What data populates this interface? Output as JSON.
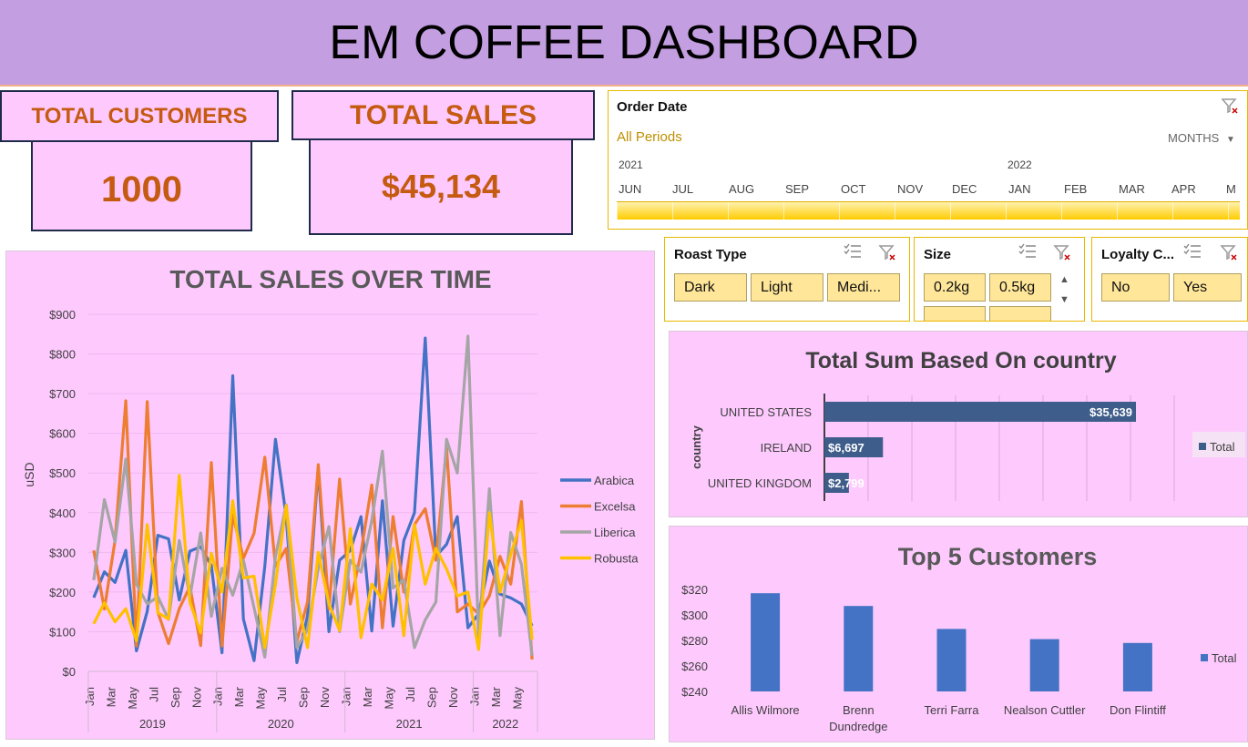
{
  "header": {
    "title": "EM COFFEE DASHBOARD"
  },
  "kpis": {
    "customers_label": "TOTAL CUSTOMERS",
    "customers_value": "1000",
    "sales_label": "TOTAL SALES",
    "sales_value": "$45,134"
  },
  "timeline": {
    "title": "Order Date",
    "periods": "All Periods",
    "unit": "MONTHS",
    "years": [
      "2021",
      "2022"
    ],
    "months": [
      "JUN",
      "JUL",
      "AUG",
      "SEP",
      "OCT",
      "NOV",
      "DEC",
      "JAN",
      "FEB",
      "MAR",
      "APR",
      "M"
    ]
  },
  "slicers": {
    "roast": {
      "title": "Roast Type",
      "items": [
        "Dark",
        "Light",
        "Medi..."
      ]
    },
    "size": {
      "title": "Size",
      "items": [
        "0.2kg",
        "0.5kg"
      ]
    },
    "loyalty": {
      "title": "Loyalty C...",
      "items": [
        "No",
        "Yes"
      ]
    }
  },
  "colors": {
    "arabica": "#4472c4",
    "excelsa": "#ed7d31",
    "liberica": "#a5a5a5",
    "robusta": "#ffc000",
    "bar": "#4472c4",
    "country_bar": "#3f5d8a"
  },
  "chart_data": [
    {
      "type": "line",
      "title": "TOTAL SALES OVER TIME",
      "ylabel": "uSD",
      "ylim": [
        0,
        900
      ],
      "yticks": [
        "$0",
        "$100",
        "$200",
        "$300",
        "$400",
        "$500",
        "$600",
        "$700",
        "$800",
        "$900"
      ],
      "month_labels": [
        "Jan",
        "Mar",
        "May",
        "Jul",
        "Sep",
        "Nov"
      ],
      "years": [
        "2019",
        "2020",
        "2021",
        "2022"
      ],
      "legend": "right",
      "series": [
        {
          "name": "Arabica",
          "values": [
            186,
            251,
            224,
            305,
            52,
            151,
            343,
            334,
            180,
            303,
            314,
            267,
            47,
            745,
            132,
            27,
            265,
            585,
            390,
            22,
            140,
            513,
            100,
            280,
            305,
            390,
            102,
            430,
            114,
            330,
            400,
            840,
            290,
            320,
            390,
            110,
            145,
            278,
            195,
            185,
            170,
            115
          ]
        },
        {
          "name": "Excelsa",
          "values": [
            305,
            157,
            330,
            682,
            64,
            680,
            149,
            70,
            158,
            214,
            65,
            526,
            64,
            395,
            285,
            348,
            540,
            265,
            310,
            75,
            175,
            521,
            158,
            485,
            170,
            300,
            470,
            110,
            390,
            200,
            370,
            410,
            280,
            565,
            150,
            170,
            145,
            190,
            290,
            220,
            428,
            30
          ]
        },
        {
          "name": "Liberica",
          "values": [
            230,
            433,
            326,
            535,
            220,
            170,
            188,
            131,
            330,
            188,
            349,
            139,
            260,
            192,
            280,
            160,
            36,
            290,
            420,
            60,
            105,
            260,
            365,
            100,
            280,
            250,
            380,
            555,
            210,
            230,
            60,
            130,
            175,
            585,
            500,
            845,
            85,
            460,
            90,
            350,
            270,
            40
          ]
        },
        {
          "name": "Robusta",
          "values": [
            120,
            173,
            125,
            158,
            77,
            370,
            148,
            132,
            494,
            174,
            97,
            298,
            200,
            430,
            235,
            240,
            60,
            220,
            418,
            185,
            60,
            300,
            170,
            103,
            360,
            85,
            220,
            180,
            310,
            90,
            370,
            220,
            310,
            258,
            190,
            200,
            55,
            400,
            200,
            295,
            380,
            80
          ]
        }
      ]
    },
    {
      "type": "bar",
      "orientation": "horizontal",
      "title": "Total Sum Based On country",
      "ylabel": "country",
      "categories": [
        "UNITED STATES",
        "IRELAND",
        "UNITED KINGDOM"
      ],
      "values": [
        35639,
        6697,
        2799
      ],
      "value_labels": [
        "$35,639",
        "$6,697",
        "$2,799"
      ],
      "legend_label": "Total",
      "legend": "right"
    },
    {
      "type": "bar",
      "title": "Top 5 Customers",
      "categories": [
        "Allis Wilmore",
        "Brenn Dundredge",
        "Terri Farra",
        "Nealson Cuttler",
        "Don Flintiff"
      ],
      "values": [
        317,
        307,
        289,
        281,
        278
      ],
      "ylim": [
        240,
        320
      ],
      "yticks": [
        "$240",
        "$260",
        "$280",
        "$300",
        "$320"
      ],
      "legend_label": "Total",
      "legend": "right"
    }
  ]
}
